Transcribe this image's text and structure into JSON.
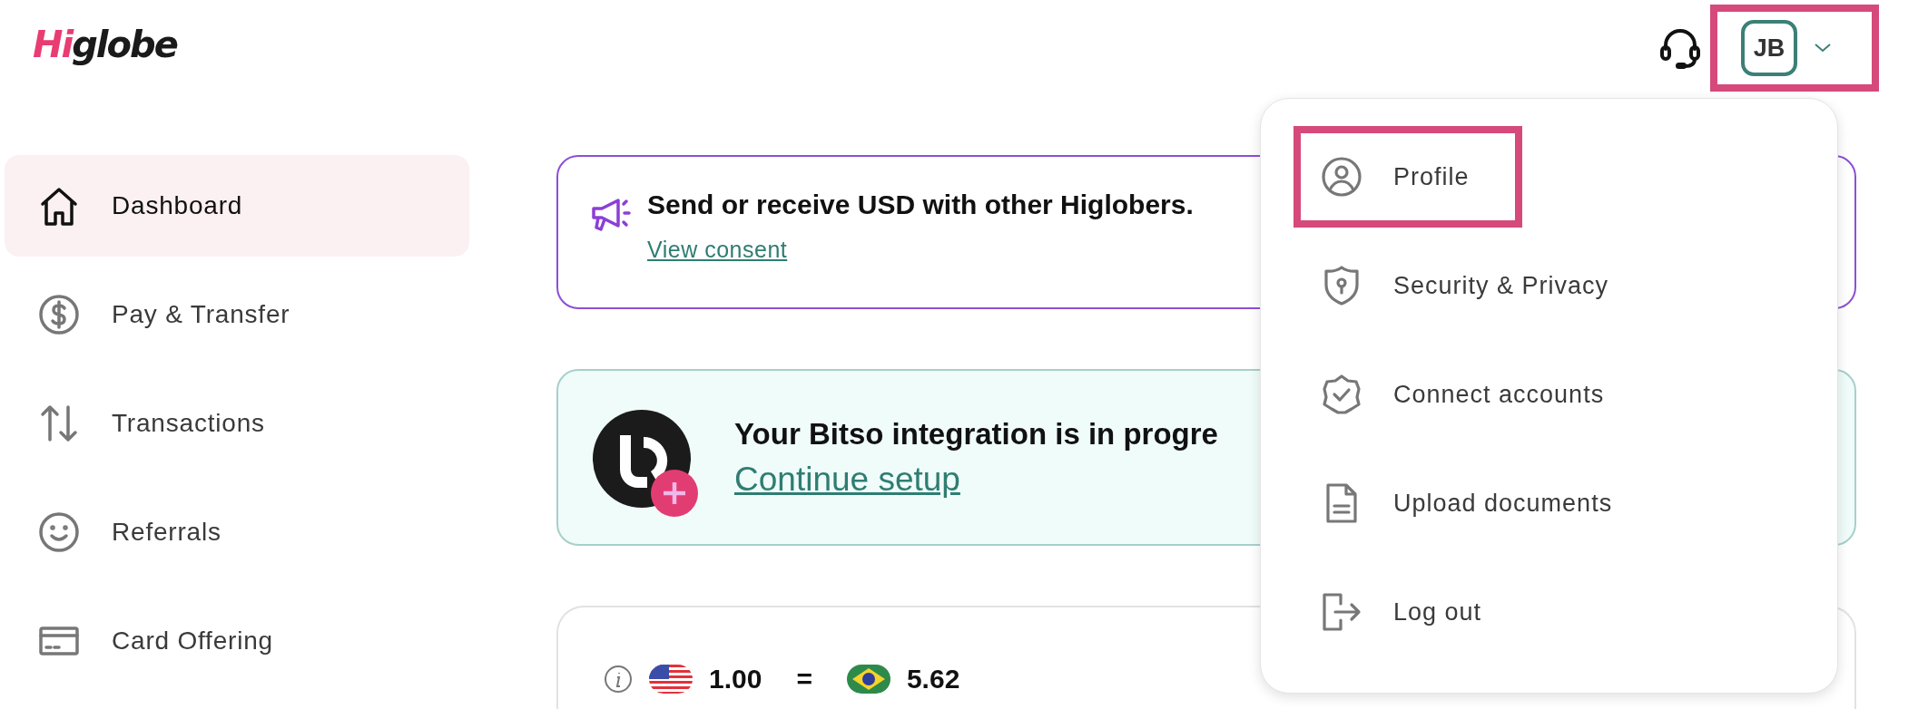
{
  "header": {
    "logo_accent": "Hi",
    "logo_rest": "globe",
    "account": {
      "initials": "JB",
      "highlighted": true
    }
  },
  "sidebar": {
    "items": [
      {
        "label": "Dashboard",
        "kind": "home",
        "selected": true
      },
      {
        "label": "Pay & Transfer",
        "kind": "dollar",
        "selected": false
      },
      {
        "label": "Transactions",
        "kind": "arrows",
        "selected": false
      },
      {
        "label": "Referrals",
        "kind": "smile",
        "selected": false
      },
      {
        "label": "Card Offering",
        "kind": "card",
        "selected": false
      }
    ]
  },
  "announcement": {
    "text": "Send or receive USD with other Higlobers.",
    "link": "View consent"
  },
  "integration": {
    "title": "Your Bitso integration is in progre",
    "link": "Continue setup"
  },
  "rate": {
    "from_amount": "1.00",
    "equals": "=",
    "to_amount": "5.62"
  },
  "menu": {
    "items": [
      {
        "label": "Profile",
        "kind": "user",
        "highlighted": true
      },
      {
        "label": "Security & Privacy",
        "kind": "shield",
        "highlighted": false
      },
      {
        "label": "Connect accounts",
        "kind": "badge",
        "highlighted": false
      },
      {
        "label": "Upload documents",
        "kind": "document",
        "highlighted": false
      },
      {
        "label": "Log out",
        "kind": "logout",
        "highlighted": false
      }
    ]
  }
}
